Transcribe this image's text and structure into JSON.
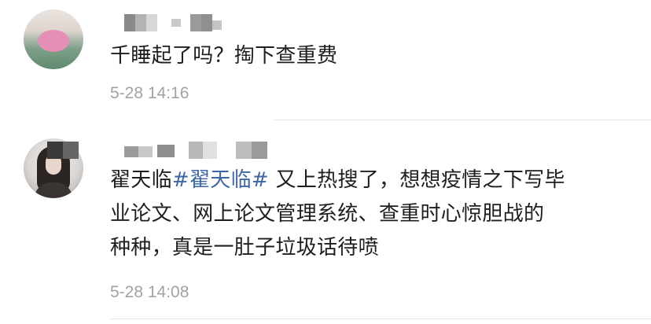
{
  "comments": [
    {
      "username": "",
      "text": "千睡起了吗？掏下查重费",
      "time": "5-28 14:16"
    },
    {
      "username": "",
      "text_before": "翟天临",
      "hashtag": "#翟天临#",
      "text_line1_after": " 又上热搜了，想想疫情之下写毕",
      "text_line2": "业论文、网上论文管理系统、查重时心惊胆战的",
      "text_line3": "种种，真是一肚子垃圾话待喷",
      "time": "5-28 14:08"
    }
  ],
  "colors": {
    "text": "#1e1e1e",
    "hashtag": "#3d66a8",
    "timestamp": "#a2a2a2",
    "divider": "#e6e6e6"
  }
}
